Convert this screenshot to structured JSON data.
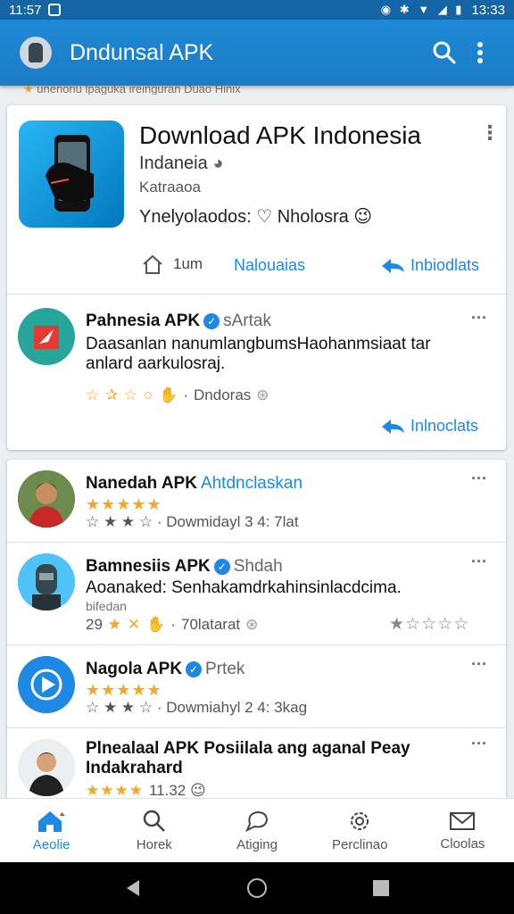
{
  "status_bar": {
    "time_left": "11:57",
    "time_right": "13:33"
  },
  "app_bar": {
    "title": "Dndunsal APK"
  },
  "ticker": {
    "text": "unenoriu lpaguka ireinguran  Duao  Hinix"
  },
  "hero": {
    "title": "Download APK Indonesia",
    "subtitle": "Indaneia",
    "category": "Katraaoa",
    "tagline": "Ynelyolaodos: ♡ Nholosra 😉",
    "home_label": "1um",
    "link_label": "Nalouaias",
    "download_label": "Inbiodlats"
  },
  "feature_post": {
    "name": "Pahnesia APK",
    "handle": "sArtak",
    "text": "Daasanlan nanumlangbumsHaohanmsiaat tar anlard aarkulosraj.",
    "meta_rating": "☆ ✰ ☆ ○",
    "meta_location": "Dndoras",
    "download_label": "Inlnoclats"
  },
  "posts": [
    {
      "name": "Nanedah APK",
      "handle": "Ahtdnclaskan",
      "rating": "★★★★★",
      "meta": "☆ ★ ★ ☆ · Dowmidayl  3  4: 7lat"
    },
    {
      "name": "Bamnesiis APK",
      "handle": "Shdah",
      "text": "Aoanaked: Senhakamdrkahinsinlacdcima.",
      "subtext": "bifedan",
      "meta_count": "29",
      "meta_location": "70latarat",
      "rating": "★☆☆☆☆"
    },
    {
      "name": "Nagola APK",
      "handle": "Prtek",
      "rating": "★★★★★",
      "meta": "☆ ★ ★ ☆ · Dowmiahyl  2  4: 3kag"
    },
    {
      "name": "Plnealaal APK Posiilala ang aganal Peay",
      "subname": "Indakrahard",
      "rating": "★★★★",
      "meta_count": "11.32 😉"
    }
  ],
  "bottom_nav": [
    {
      "label": "Aeolie"
    },
    {
      "label": "Horek"
    },
    {
      "label": "Atiging"
    },
    {
      "label": "Perclinao"
    },
    {
      "label": "Cloolas"
    }
  ],
  "colors": {
    "primary": "#1e88e5",
    "app_bar": "#1b7cc6",
    "star": "#f5a623"
  }
}
